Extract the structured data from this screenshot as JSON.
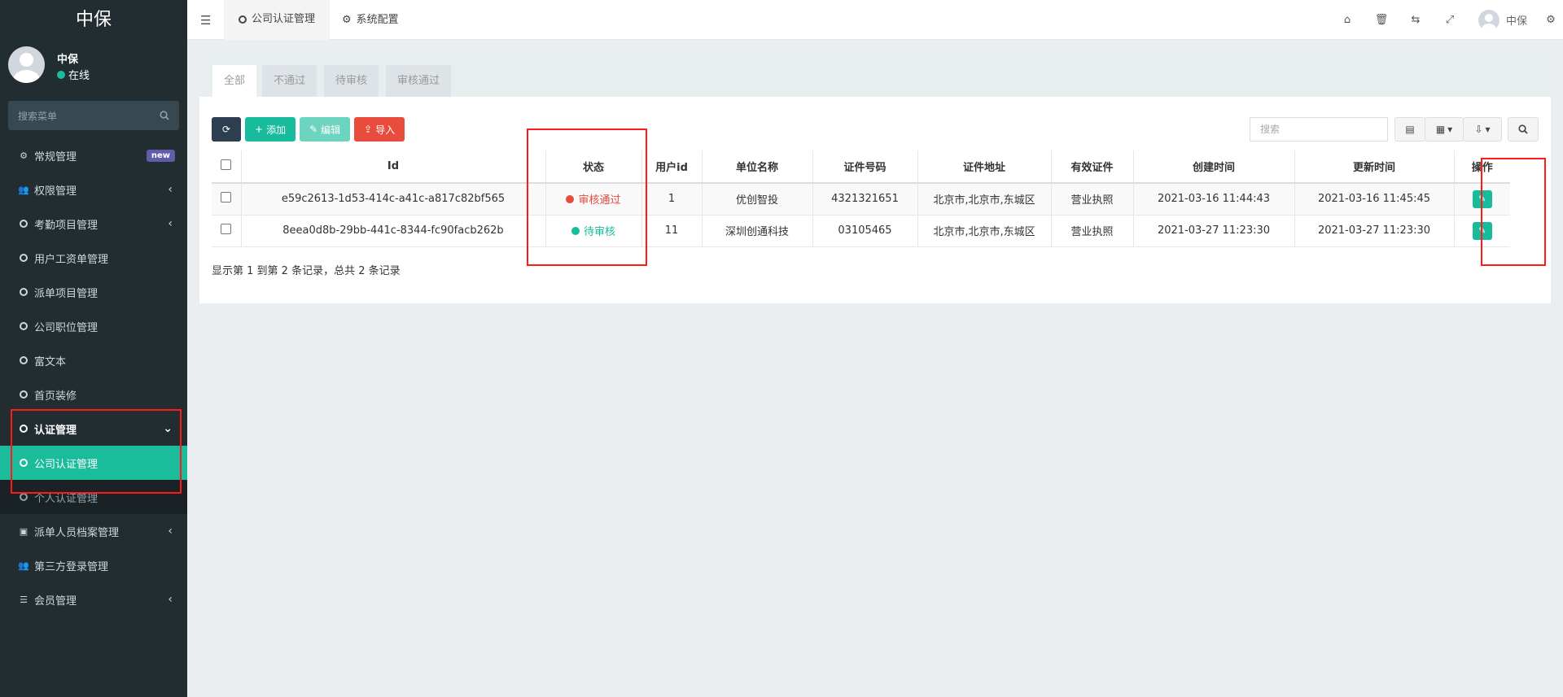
{
  "sidebar": {
    "brand": "中保",
    "user": {
      "name": "中保",
      "status": "在线"
    },
    "search_placeholder": "搜索菜单",
    "items": [
      {
        "label": "常规管理",
        "icon": "gears-icon",
        "badge": "new"
      },
      {
        "label": "权限管理",
        "icon": "users-icon",
        "caret": "‹"
      },
      {
        "label": "考勤项目管理",
        "icon": "circle-icon",
        "caret": "‹"
      },
      {
        "label": "用户工资单管理",
        "icon": "circle-icon"
      },
      {
        "label": "派单项目管理",
        "icon": "circle-icon"
      },
      {
        "label": "公司职位管理",
        "icon": "circle-icon"
      },
      {
        "label": "富文本",
        "icon": "circle-icon"
      },
      {
        "label": "首页装修",
        "icon": "circle-icon"
      },
      {
        "label": "认证管理",
        "icon": "circle-icon",
        "caret": "⌄"
      },
      {
        "label": "公司认证管理",
        "icon": "circle-icon"
      },
      {
        "label": "个人认证管理",
        "icon": "circle-icon"
      },
      {
        "label": "派单人员档案管理",
        "icon": "id-card-icon",
        "caret": "‹"
      },
      {
        "label": "第三方登录管理",
        "icon": "users-icon"
      },
      {
        "label": "会员管理",
        "icon": "list-icon",
        "caret": "‹"
      }
    ]
  },
  "topbar": {
    "tabs": [
      {
        "label": "公司认证管理"
      },
      {
        "label": "系统配置"
      }
    ],
    "user_name": "中保"
  },
  "panel": {
    "tabs": [
      "全部",
      "不通过",
      "待审核",
      "审核通过"
    ],
    "toolbar": {
      "add": "添加",
      "edit": "编辑",
      "import": "导入"
    },
    "search_placeholder": "搜索",
    "columns": [
      "Id",
      "状态",
      "用户id",
      "单位名称",
      "证件号码",
      "证件地址",
      "有效证件",
      "创建时间",
      "更新时间",
      "操作"
    ],
    "rows": [
      {
        "id": "e59c2613-1d53-414c-a41c-a817c82bf565",
        "status": "审核通过",
        "user_id": "1",
        "company": "优创智投",
        "cert_no": "4321321651",
        "address": "北京市,北京市,东城区",
        "cert_type": "营业执照",
        "created": "2021-03-16 11:44:43",
        "updated": "2021-03-16 11:45:45"
      },
      {
        "id": "8eea0d8b-29bb-441c-8344-fc90facb262b",
        "status": "待审核",
        "user_id": "11",
        "company": "深圳创通科技",
        "cert_no": "03105465",
        "address": "北京市,北京市,东城区",
        "cert_type": "营业执照",
        "created": "2021-03-27 11:23:30",
        "updated": "2021-03-27 11:23:30"
      }
    ],
    "footer": "显示第 1 到第 2 条记录，总共 2 条记录"
  },
  "colors": {
    "accent": "#18bc9c",
    "danger": "#e74c3c",
    "sidebar_bg": "#222d32",
    "highlight": "#ff1a1a"
  }
}
